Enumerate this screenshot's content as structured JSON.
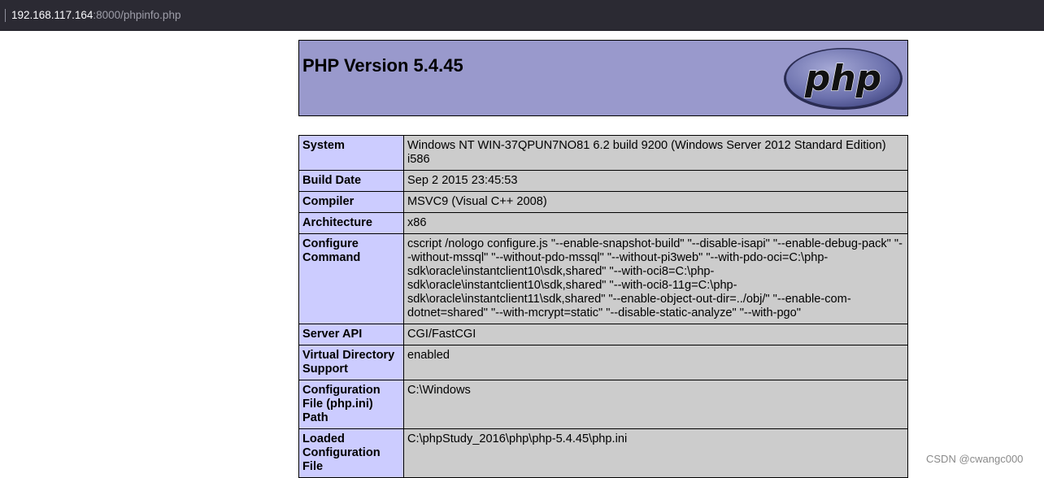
{
  "browser": {
    "url_host": "192.168.117.164",
    "url_rest": ":8000/phpinfo.php"
  },
  "header": {
    "title": "PHP Version 5.4.45",
    "logo_text": "php",
    "logo_bg": "#9999cc"
  },
  "rows": [
    {
      "key": "System",
      "value": "Windows NT WIN-37QPUN7NO81 6.2 build 9200 (Windows Server 2012 Standard Edition) i586"
    },
    {
      "key": "Build Date",
      "value": "Sep 2 2015 23:45:53"
    },
    {
      "key": "Compiler",
      "value": "MSVC9 (Visual C++ 2008)"
    },
    {
      "key": "Architecture",
      "value": "x86"
    },
    {
      "key": "Configure Command",
      "value": "cscript /nologo configure.js \"--enable-snapshot-build\" \"--disable-isapi\" \"--enable-debug-pack\" \"--without-mssql\" \"--without-pdo-mssql\" \"--without-pi3web\" \"--with-pdo-oci=C:\\php-sdk\\oracle\\instantclient10\\sdk,shared\" \"--with-oci8=C:\\php-sdk\\oracle\\instantclient10\\sdk,shared\" \"--with-oci8-11g=C:\\php-sdk\\oracle\\instantclient11\\sdk,shared\" \"--enable-object-out-dir=../obj/\" \"--enable-com-dotnet=shared\" \"--with-mcrypt=static\" \"--disable-static-analyze\" \"--with-pgo\""
    },
    {
      "key": "Server API",
      "value": "CGI/FastCGI"
    },
    {
      "key": "Virtual Directory Support",
      "value": "enabled"
    },
    {
      "key": "Configuration File (php.ini) Path",
      "value": "C:\\Windows"
    },
    {
      "key": "Loaded Configuration File",
      "value": "C:\\phpStudy_2016\\php\\php-5.4.45\\php.ini"
    }
  ],
  "colors": {
    "key_cell": "#ccccff",
    "value_cell": "#cccccc",
    "header": "#9999cc"
  },
  "watermark": "CSDN @cwangc000"
}
